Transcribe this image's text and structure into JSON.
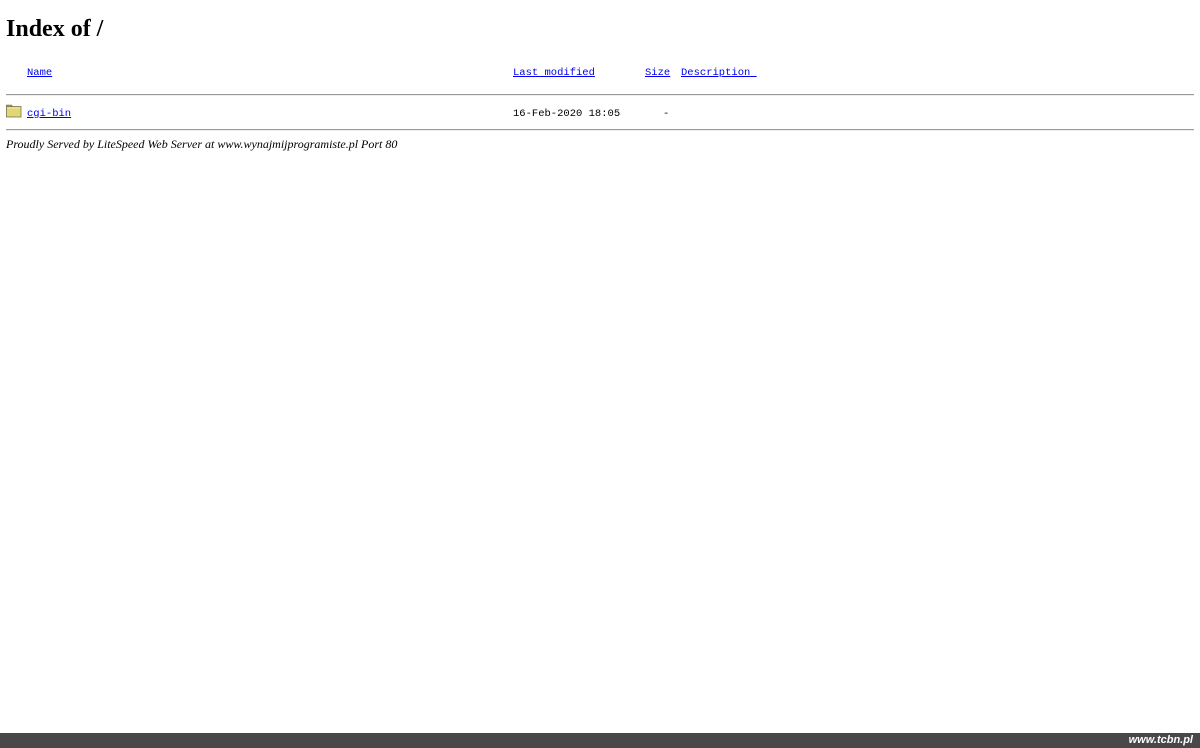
{
  "page": {
    "title": "Index of /"
  },
  "table": {
    "columns": {
      "name": "Name",
      "last_modified": "Last modified",
      "size": "Size",
      "description": "Description"
    },
    "rows": [
      {
        "icon": "folder-icon",
        "name": "cgi-bin",
        "last_modified": "16-Feb-2020 18:05",
        "size": "-",
        "description": ""
      }
    ]
  },
  "footer": {
    "server_signature": "Proudly Served by LiteSpeed Web Server at www.wynajmijprogramiste.pl Port 80"
  },
  "watermark": {
    "text": "www.tcbn.pl"
  },
  "colors": {
    "link": "#0000ee",
    "folder_fill": "#e0d878",
    "rule": "#9a9a9a",
    "bottom_bar": "#484848"
  }
}
